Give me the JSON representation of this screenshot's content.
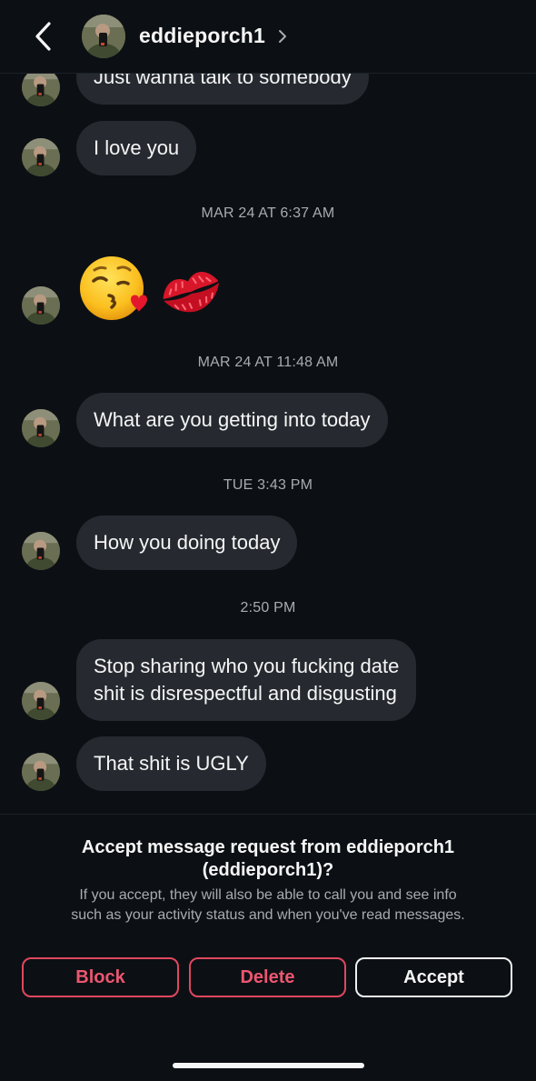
{
  "header": {
    "username": "eddieporch1",
    "back_icon": "chevron-left-icon",
    "chevron_icon": "chevron-right-icon"
  },
  "messages": [
    {
      "type": "text",
      "text": "Just wanna talk to somebody"
    },
    {
      "type": "text",
      "text": "I love you"
    },
    {
      "type": "timestamp",
      "text": "MAR 24 AT 6:37 AM"
    },
    {
      "type": "emoji",
      "items": [
        "kissing-face-with-heart-emoji",
        "kiss-mark-lips-emoji"
      ]
    },
    {
      "type": "timestamp",
      "text": "MAR 24 AT 11:48 AM"
    },
    {
      "type": "text",
      "text": "What are you getting into today"
    },
    {
      "type": "timestamp",
      "text": "TUE 3:43 PM"
    },
    {
      "type": "text",
      "text": "How you doing today"
    },
    {
      "type": "timestamp",
      "text": "2:50 PM"
    },
    {
      "type": "text",
      "lines": [
        "Stop sharing who you fucking date",
        "shit is disrespectful and disgusting"
      ]
    },
    {
      "type": "text",
      "text": "That shit is UGLY"
    }
  ],
  "request": {
    "title_line1": "Accept message request from eddieporch1",
    "title_line2": "(eddieporch1)?",
    "subtitle_line1": "If you accept, they will also be able to call you and see info",
    "subtitle_line2": "such as your activity status and when you've read messages.",
    "block_label": "Block",
    "delete_label": "Delete",
    "accept_label": "Accept"
  },
  "colors": {
    "background": "#0c1014",
    "bubble": "#262a30",
    "danger": "#ec5670",
    "secondary_text": "#a8acb2"
  }
}
